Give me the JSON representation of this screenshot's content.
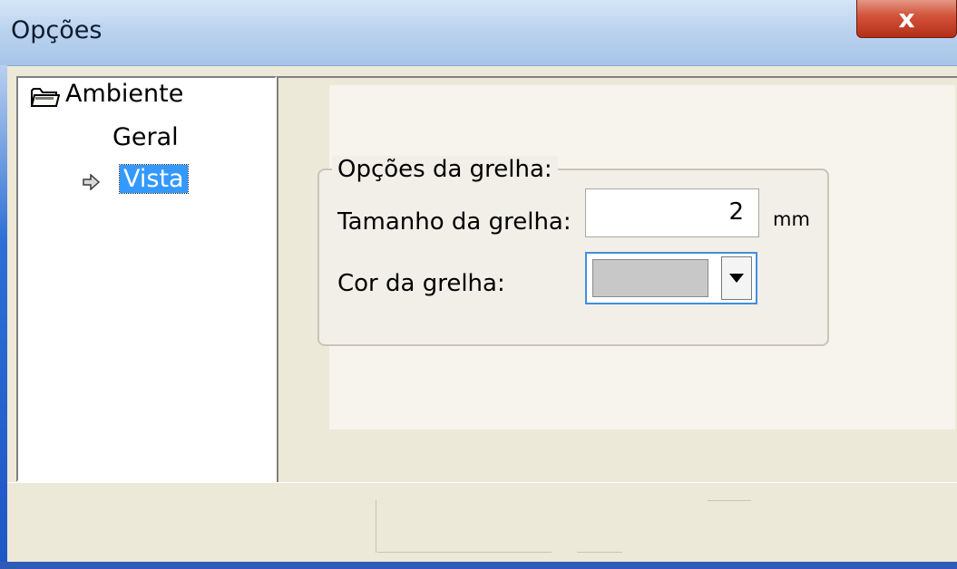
{
  "window": {
    "title": "Opções",
    "close_label": "x"
  },
  "tree": {
    "items": [
      {
        "label": "Ambiente",
        "icon": "folder-icon"
      },
      {
        "label": "Geral"
      },
      {
        "label": "Vista",
        "icon": "arrow-right-icon",
        "selected": true
      }
    ]
  },
  "grid_options": {
    "legend": "Opções da grelha:",
    "size_label": "Tamanho da grelha:",
    "size_value": "2",
    "size_unit": "mm",
    "color_label": "Cor da grelha:",
    "color_value": "#c8c8c8"
  }
}
